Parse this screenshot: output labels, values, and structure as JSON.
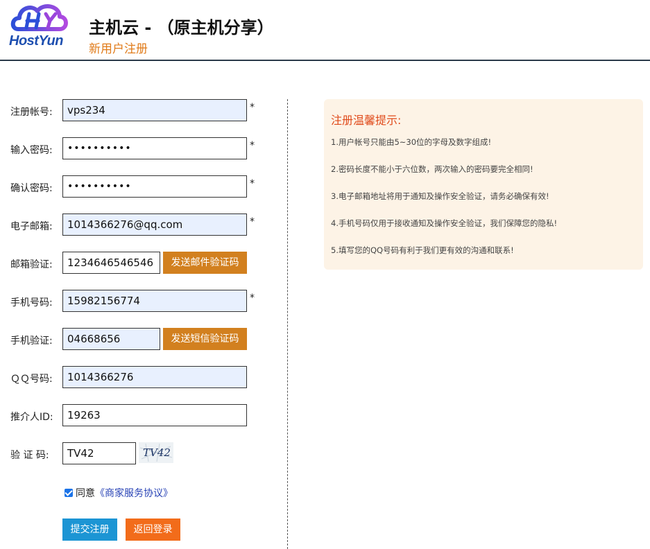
{
  "header": {
    "logo_text": "HostYun",
    "title": "主机云 - （原主机分享）",
    "subtitle": "新用户注册"
  },
  "form": {
    "account": {
      "label": "注册帐号:",
      "value": "vps234",
      "required": "*"
    },
    "password": {
      "label": "输入密码:",
      "value": "••••••••••",
      "required": "*"
    },
    "confirm_password": {
      "label": "确认密码:",
      "value": "••••••••••",
      "required": "*"
    },
    "email": {
      "label": "电子邮箱:",
      "value": "1014366276@qq.com",
      "required": "*"
    },
    "email_verify": {
      "label": "邮箱验证:",
      "value": "1234646546546",
      "button": "发送邮件验证码"
    },
    "phone": {
      "label": "手机号码:",
      "value": "15982156774",
      "required": "*"
    },
    "phone_verify": {
      "label": "手机验证:",
      "value": "04668656",
      "button": "发送短信验证码"
    },
    "qq": {
      "label": "ＱＱ号码:",
      "value": "1014366276"
    },
    "referrer": {
      "label": "推介人ID:",
      "value": "19263"
    },
    "captcha": {
      "label": "验 证 码:",
      "value": "TV42",
      "image_text": "TV42"
    },
    "agree": {
      "text": "同意",
      "link": "《商家服务协议》",
      "checked": true
    },
    "submit_label": "提交注册",
    "back_label": "返回登录"
  },
  "tips": {
    "title": "注册温馨提示:",
    "items": [
      "1.用户帐号只能由5~30位的字母及数字组成!",
      "2.密码长度不能小于六位数，两次输入的密码要完全相同!",
      "3.电子邮箱地址将用于通知及操作安全验证，请务必确保有效!",
      "4.手机号码仅用于接收通知及操作安全验证，我们保障您的隐私!",
      "5.填写您的QQ号码有利于我们更有效的沟通和联系!"
    ]
  },
  "colors": {
    "accent_orange": "#e07b1a",
    "send_button": "#d2801f",
    "submit_button": "#1c95d4",
    "back_button": "#f26c1a",
    "tips_background": "#fdf3e6",
    "tips_title": "#e04a1a"
  }
}
